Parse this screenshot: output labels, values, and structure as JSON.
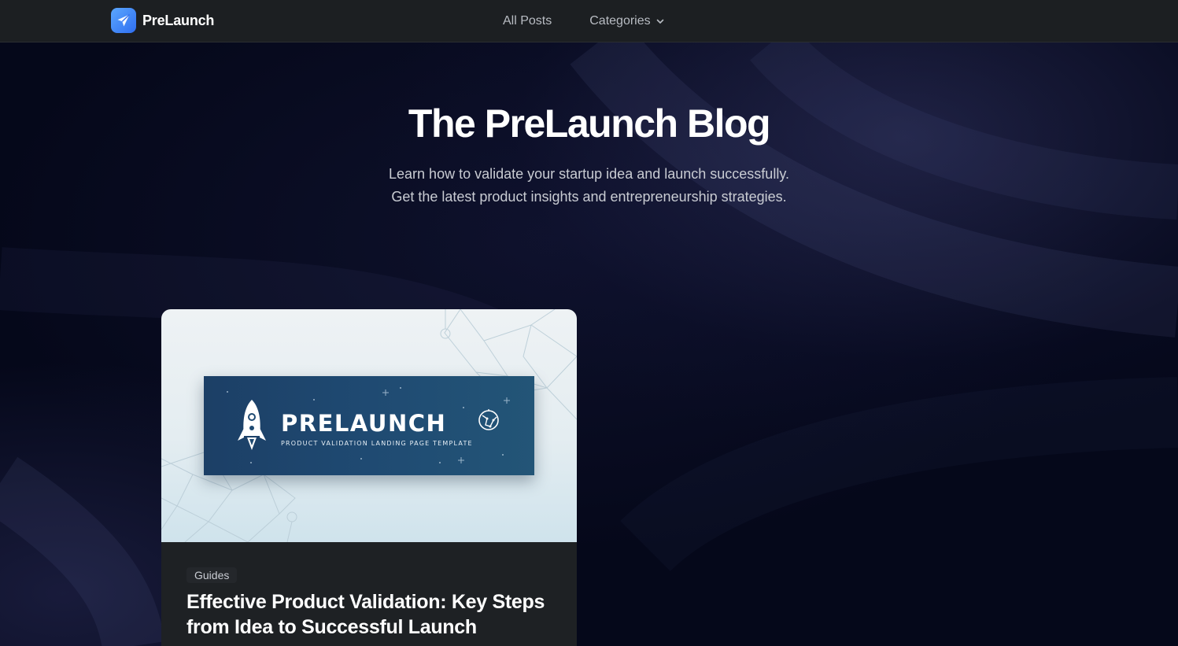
{
  "nav": {
    "brand_name": "PreLaunch",
    "brand_icon": "paper-plane-icon",
    "links": [
      {
        "label": "All Posts"
      },
      {
        "label": "Categories",
        "icon": "chevron-down-icon"
      }
    ]
  },
  "hero": {
    "title": "The PreLaunch Blog",
    "subtitle_line1": "Learn how to validate your startup idea and launch successfully.",
    "subtitle_line2": "Get the latest product insights and entrepreneurship strategies."
  },
  "posts": [
    {
      "image": {
        "banner_title": "PRELAUNCH",
        "banner_tagline": "PRODUCT VALIDATION LANDING PAGE TEMPLATE",
        "banner_icons": [
          "rocket-icon",
          "globe-icon"
        ]
      },
      "category": "Guides",
      "title": "Effective Product Validation: Key Steps from Idea to Successful Launch"
    }
  ],
  "colors": {
    "nav_bg": "#1c1f22",
    "page_bg": "#05081a",
    "brand_accent": "#3b82f6",
    "card_bg": "#1e2124",
    "banner_bg": "#1f4a72"
  }
}
